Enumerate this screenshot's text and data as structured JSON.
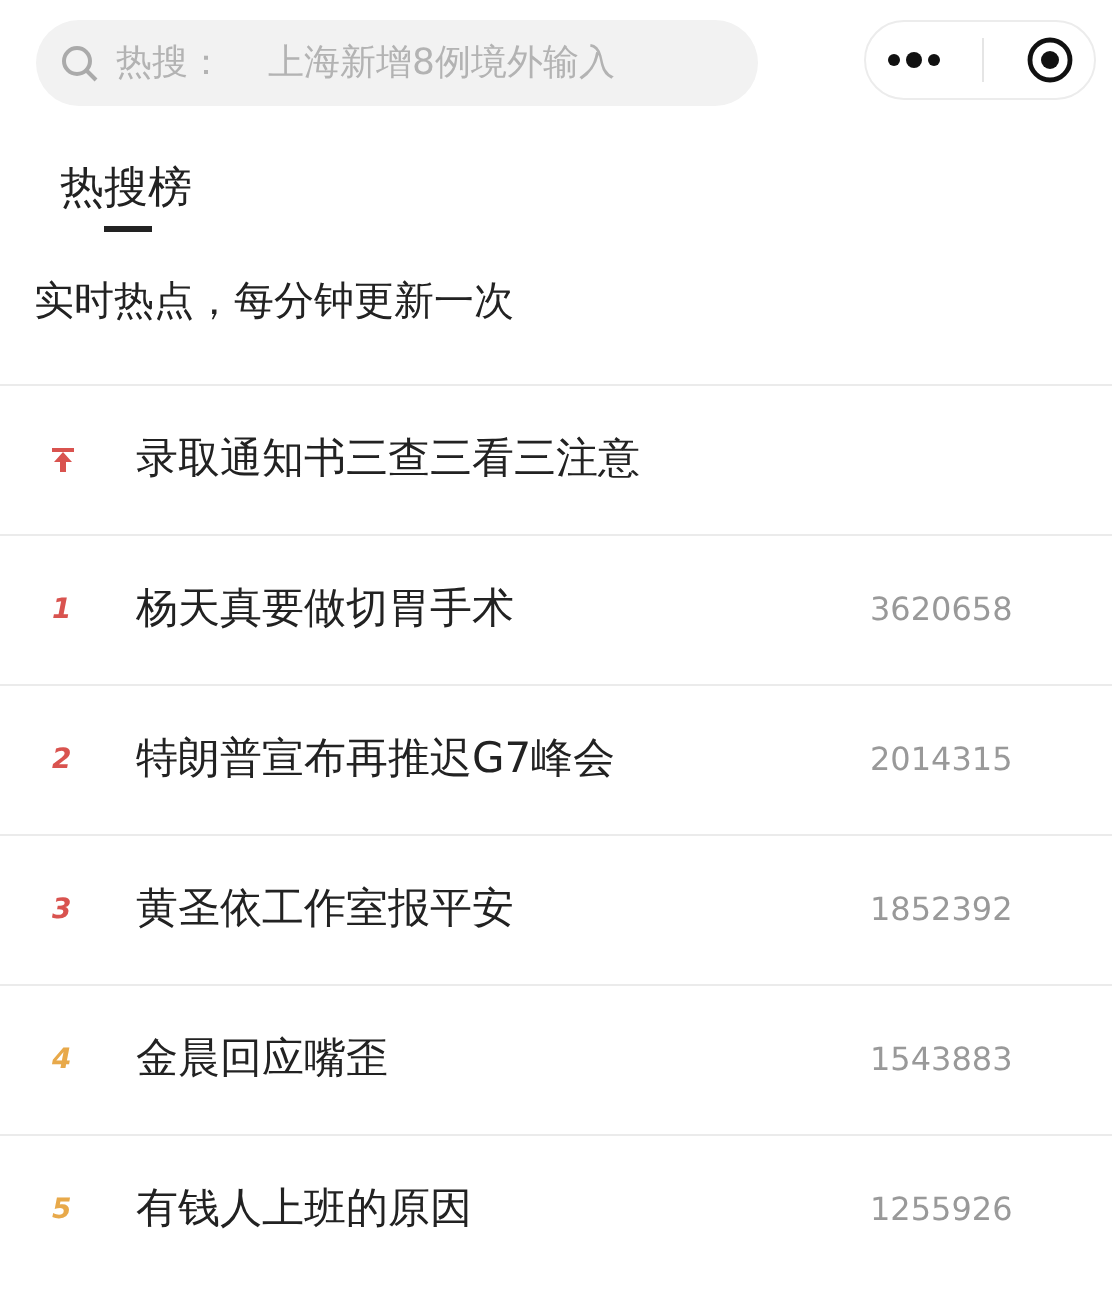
{
  "search": {
    "placeholder_label": "热搜：",
    "placeholder": "上海新增8例境外输入"
  },
  "tabs": [
    {
      "label": "热搜榜",
      "selected": true
    }
  ],
  "subtitle": "实时热点，每分钟更新一次",
  "items": [
    {
      "kind": "pinned",
      "title": "录取通知书三查三看三注意",
      "color": "#d9534f"
    },
    {
      "kind": "ranked",
      "rank": "1",
      "title": "杨天真要做切胃手术",
      "count": "3620658",
      "color": "#d9534f"
    },
    {
      "kind": "ranked",
      "rank": "2",
      "title": "特朗普宣布再推迟G7峰会",
      "count": "2014315",
      "color": "#d9534f"
    },
    {
      "kind": "ranked",
      "rank": "3",
      "title": "黄圣依工作室报平安",
      "count": "1852392",
      "color": "#d9534f"
    },
    {
      "kind": "ranked",
      "rank": "4",
      "title": "金晨回应嘴歪",
      "count": "1543883",
      "color": "#e8a94a"
    },
    {
      "kind": "ranked",
      "rank": "5",
      "title": "有钱人上班的原因",
      "count": "1255926",
      "color": "#e8a94a"
    }
  ]
}
